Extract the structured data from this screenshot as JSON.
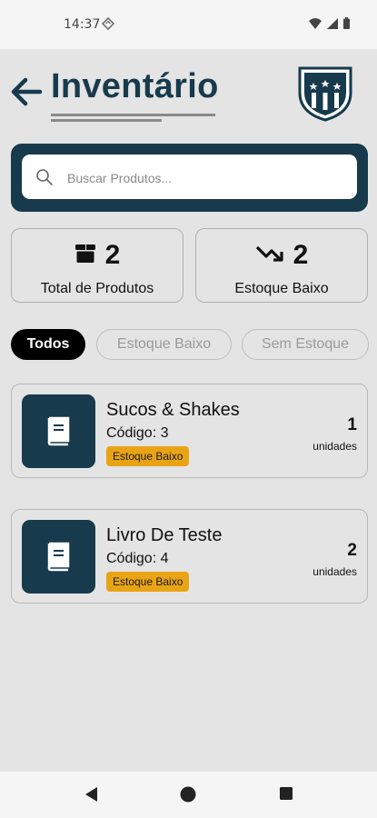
{
  "status": {
    "time": "14:37"
  },
  "header": {
    "title": "Inventário"
  },
  "search": {
    "placeholder": "Buscar Produtos..."
  },
  "stats": [
    {
      "value": "2",
      "label": "Total de Produtos",
      "icon": "box-icon"
    },
    {
      "value": "2",
      "label": "Estoque Baixo",
      "icon": "trending-down-icon"
    }
  ],
  "filters": [
    {
      "label": "Todos",
      "active": true
    },
    {
      "label": "Estoque Baixo",
      "active": false
    },
    {
      "label": "Sem Estoque",
      "active": false
    }
  ],
  "products": [
    {
      "name": "Sucos & Shakes",
      "code": "Código: 3",
      "badge": "Estoque Baixo",
      "quantity": "1",
      "unit": "unidades"
    },
    {
      "name": "Livro De Teste",
      "code": "Código: 4",
      "badge": "Estoque Baixo",
      "quantity": "2",
      "unit": "unidades"
    }
  ],
  "colors": {
    "primary": "#173a4d",
    "badge": "#e8a415",
    "background": "#e4e4e4"
  }
}
